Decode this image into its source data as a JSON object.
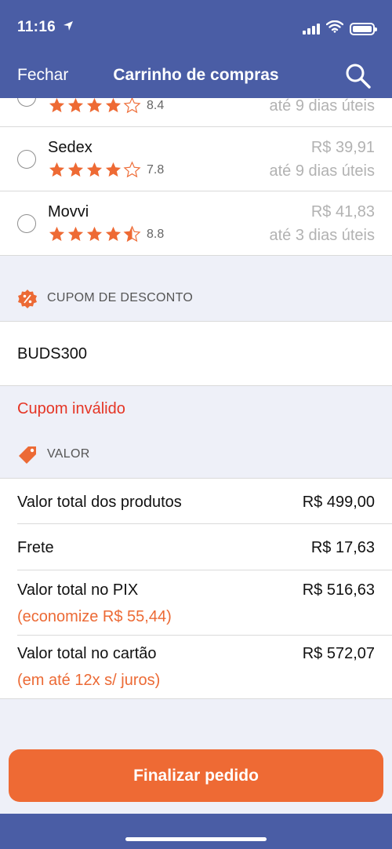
{
  "status": {
    "time": "11:16"
  },
  "nav": {
    "close_label": "Fechar",
    "title": "Carrinho de compras"
  },
  "shipping": {
    "partial": {
      "rating": "8.4",
      "days": "até 9 dias úteis",
      "stars": 4
    },
    "options": [
      {
        "name": "Sedex",
        "rating": "7.8",
        "stars": 4,
        "price": "R$ 39,91",
        "days": "até 9 dias úteis"
      },
      {
        "name": "Movvi",
        "rating": "8.8",
        "stars": 4.5,
        "price": "R$ 41,83",
        "days": "até 3 dias úteis"
      }
    ]
  },
  "coupon": {
    "header": "CUPOM DE DESCONTO",
    "value": "BUDS300",
    "error": "Cupom inválido"
  },
  "valor": {
    "header": "VALOR",
    "rows": [
      {
        "label": "Valor total dos produtos",
        "amount": "R$ 499,00"
      },
      {
        "label": "Frete",
        "amount": "R$ 17,63"
      },
      {
        "label": "Valor total no PIX",
        "amount": "R$ 516,63",
        "note": "(economize R$ 55,44)"
      },
      {
        "label": "Valor total no cartão",
        "amount": "R$ 572,07",
        "note": "(em até 12x s/ juros)"
      }
    ]
  },
  "cta": {
    "label": "Finalizar pedido"
  },
  "colors": {
    "header": "#4a5da5",
    "accent": "#ee6a34",
    "error": "#e53525"
  },
  "icons": [
    "location-arrow-icon",
    "signal-icon",
    "wifi-icon",
    "battery-icon",
    "search-icon",
    "star-icon",
    "discount-badge-icon",
    "price-tag-icon"
  ]
}
